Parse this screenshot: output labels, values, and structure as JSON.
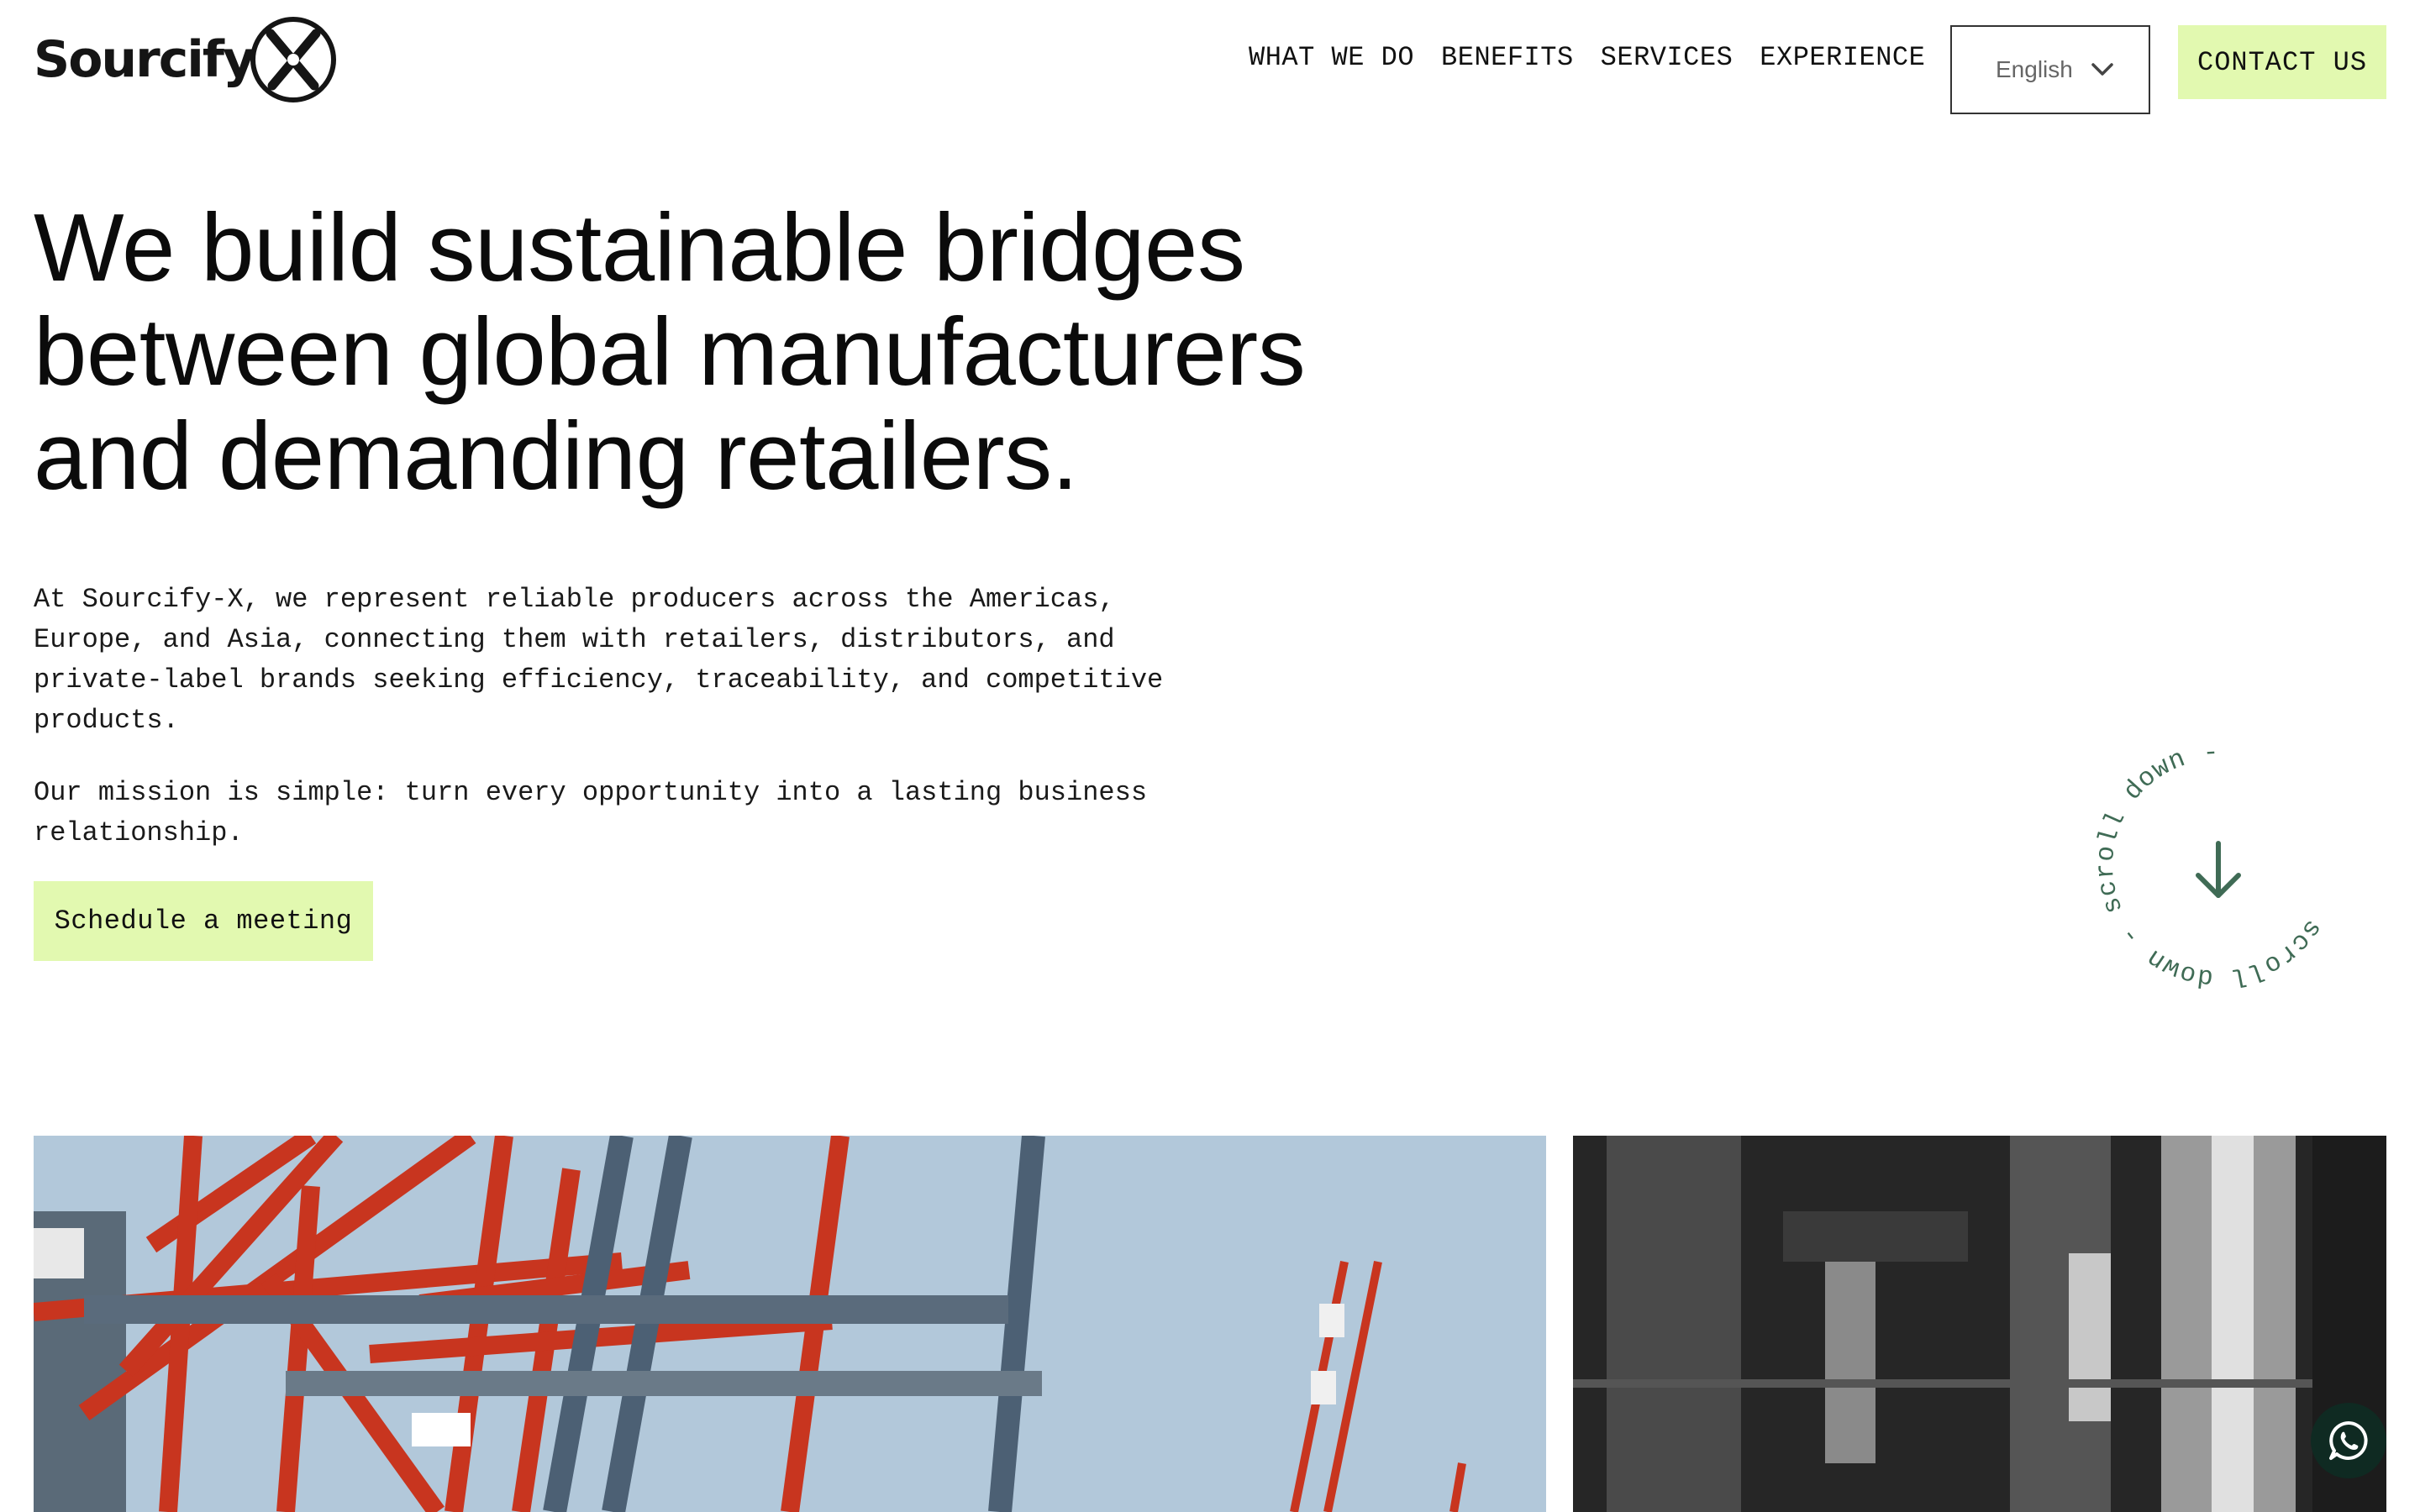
{
  "brand": {
    "name": "Sourcify"
  },
  "nav": {
    "items": [
      {
        "label": "WHAT WE DO"
      },
      {
        "label": "BENEFITS"
      },
      {
        "label": "SERVICES"
      },
      {
        "label": "EXPERIENCE"
      }
    ]
  },
  "language": {
    "selected": "English"
  },
  "contact": {
    "label": "CONTACT US"
  },
  "hero": {
    "title": "We build sustainable bridges between global manufacturers and demanding retailers.",
    "paragraph1": "At Sourcify-X, we represent reliable producers across the Americas, Europe, and Asia, connecting them with retailers, distributors, and private-label brands seeking efficiency, traceability, and competitive products.",
    "paragraph2": "Our mission is simple: turn every opportunity into a lasting business relationship.",
    "cta": "Schedule a meeting"
  },
  "scroll_badge": {
    "text": "scroll down - scroll down - "
  },
  "colors": {
    "accent": "#e2f9b0",
    "badge_green": "#3f6b55",
    "whatsapp_bg": "#0f2a22"
  },
  "icons": [
    "logo-x-icon",
    "chevron-down-icon",
    "arrow-down-icon",
    "whatsapp-icon"
  ]
}
